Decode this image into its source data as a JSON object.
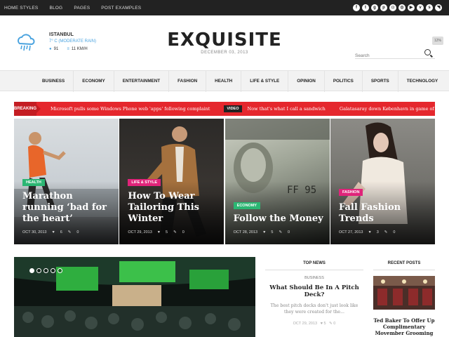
{
  "top_nav": [
    "HOME STYLES",
    "BLOG",
    "PAGES",
    "POST EXAMPLES"
  ],
  "social_icons": [
    "facebook-icon",
    "twitter-icon",
    "google-plus-icon",
    "pinterest-icon",
    "instagram-icon",
    "dribbble-icon",
    "youtube-icon",
    "vimeo-icon",
    "skype-icon",
    "rss-icon"
  ],
  "weather": {
    "city": "ISTANBUL",
    "temp": "7° C (MODERATE RAIN)",
    "humidity": "91",
    "wind": "11 KM/H"
  },
  "site": {
    "logo": "EXQUISITE",
    "date": "DECEMBER 03, 2013"
  },
  "search": {
    "placeholder": "Search",
    "badge": "12%"
  },
  "main_nav": [
    "BUSINESS",
    "ECONOMY",
    "ENTERTAINMENT",
    "FASHION",
    "HEALTH",
    "LIFE & STYLE",
    "OPINION",
    "POLITICS",
    "SPORTS",
    "TECHNOLOGY"
  ],
  "breaking": {
    "label": "BREAKING NEWS",
    "item1": "Microsoft pulls some Windows Phone web 'apps' following complaint",
    "video_tag": "VIDEO",
    "item2": "Now that's what I call a sandwich",
    "item3": "Galatasaray down København in game of first"
  },
  "tiles": [
    {
      "category": "HEALTH",
      "cat_color": "#2bb673",
      "title": "Marathon running ‘bad for the heart’",
      "date": "OCT 30, 2013",
      "views": "6",
      "comments": "0"
    },
    {
      "category": "LIFE & STYLE",
      "cat_color": "#e0247a",
      "title": "How To Wear Tailoring This Winter",
      "date": "OCT 29, 2013",
      "views": "5",
      "comments": "0"
    },
    {
      "category": "ECONOMY",
      "cat_color": "#2bb673",
      "title": "Follow the Money",
      "date": "OCT 28, 2013",
      "views": "5",
      "comments": "0"
    },
    {
      "category": "FASHION",
      "cat_color": "#e0247a",
      "title": "Fall Fashion Trends",
      "date": "OCT 27, 2013",
      "views": "3",
      "comments": "0"
    }
  ],
  "top_news": {
    "heading": "TOP NEWS",
    "category": "BUSINESS",
    "title": "What Should Be In A Pitch Deck?",
    "excerpt": "The best pitch decks don't just look like they were created for the...",
    "date": "OCT 29, 2013",
    "views": "5",
    "comments": "0"
  },
  "recent_posts": {
    "heading": "RECENT POSTS",
    "title": "Ted Baker To Offer Up Complimentary Movember Grooming"
  }
}
